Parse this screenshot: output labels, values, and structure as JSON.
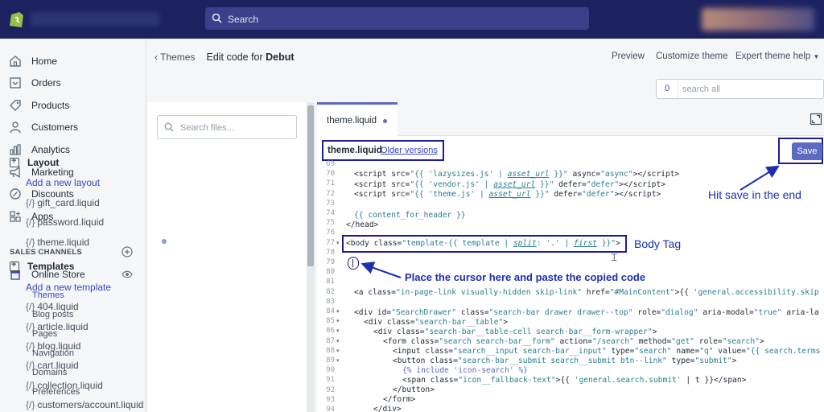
{
  "topbar": {
    "search_placeholder": "Search"
  },
  "sidebar": {
    "items": [
      {
        "label": "Home",
        "icon": "home-icon"
      },
      {
        "label": "Orders",
        "icon": "orders-icon"
      },
      {
        "label": "Products",
        "icon": "tag-icon"
      },
      {
        "label": "Customers",
        "icon": "person-icon"
      },
      {
        "label": "Analytics",
        "icon": "bar-chart-icon"
      },
      {
        "label": "Marketing",
        "icon": "megaphone-icon"
      },
      {
        "label": "Discounts",
        "icon": "discount-icon"
      },
      {
        "label": "Apps",
        "icon": "apps-icon"
      }
    ],
    "sales_channels_title": "SALES CHANNELS",
    "online_store_label": "Online Store",
    "online_store_sub": [
      "Themes",
      "Blog posts",
      "Pages",
      "Navigation",
      "Domains",
      "Preferences"
    ]
  },
  "header": {
    "back_label": "Themes",
    "edit_prefix": "Edit code for",
    "theme_name": "Debut",
    "preview_label": "Preview",
    "customize_label": "Customize theme",
    "expert_label": "Expert theme help"
  },
  "filter": {
    "count": "0",
    "placeholder": "search all"
  },
  "files": {
    "search_placeholder": "Search files...",
    "layout_title": "Layout",
    "add_layout": "Add a new layout",
    "layout_files": [
      "gift_card.liquid",
      "password.liquid",
      "theme.liquid"
    ],
    "templates_title": "Templates",
    "add_template": "Add a new template",
    "template_files": [
      "404.liquid",
      "article.liquid",
      "blog.liquid",
      "cart.liquid",
      "collection.liquid",
      "customers/account.liquid"
    ],
    "file_prefix": "{/}"
  },
  "editor": {
    "tab_label": "theme.liquid",
    "file_name": "theme.liquid",
    "older_versions": "Older versions",
    "save_label": "Save",
    "line_numbers": [
      "69",
      "70",
      "71",
      "72",
      "73",
      "74",
      "75",
      "76",
      "77",
      "78",
      "79",
      "80",
      "81",
      "82",
      "83",
      "84",
      "85",
      "86",
      "87",
      "88",
      "89",
      "90",
      "91",
      "92",
      "93",
      "94"
    ]
  },
  "annotations": {
    "hit_save": "Hit save in the end",
    "body_tag": "Body Tag",
    "place_cursor": "Place the cursor here and paste the copied code"
  },
  "colors": {
    "topbar": "#1c2260",
    "accent": "#5c6ac4",
    "annotation": "#1c2fb0",
    "link": "#3b47c1"
  }
}
